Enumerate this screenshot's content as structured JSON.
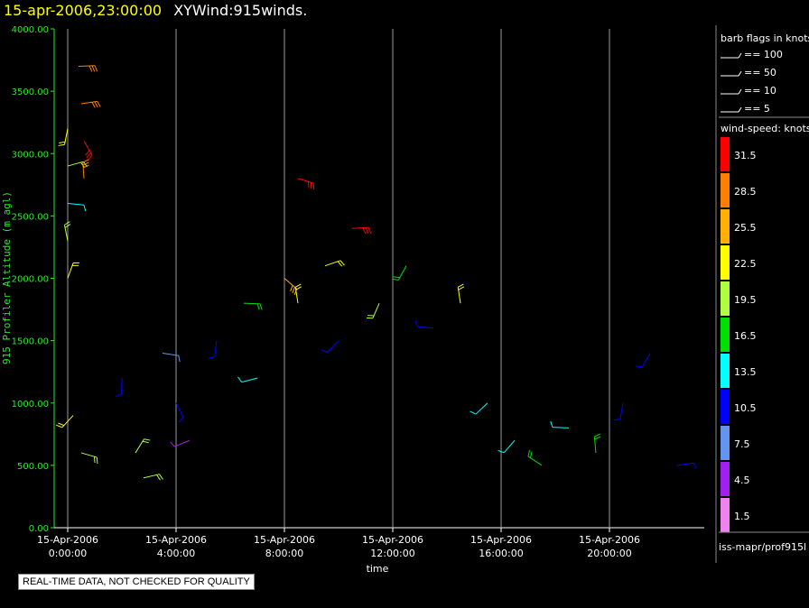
{
  "header": {
    "date_time": "15-apr-2006,23:00:00",
    "product": "XYWind:915winds."
  },
  "legend": {
    "barb_title": "barb flags in knots",
    "barb_items": [
      "== 100",
      "== 50",
      "== 10",
      "== 5"
    ],
    "speed_title": "wind-speed: knots",
    "speed_bins": [
      {
        "label": "31.5",
        "color": "#ff0000"
      },
      {
        "label": "28.5",
        "color": "#ff8000"
      },
      {
        "label": "25.5",
        "color": "#ffb000"
      },
      {
        "label": "22.5",
        "color": "#ffff00"
      },
      {
        "label": "19.5",
        "color": "#b0ff40"
      },
      {
        "label": "16.5",
        "color": "#00e000"
      },
      {
        "label": "13.5",
        "color": "#00ffff"
      },
      {
        "label": "10.5",
        "color": "#0000ff"
      },
      {
        "label": "7.5",
        "color": "#6495ed"
      },
      {
        "label": "4.5",
        "color": "#a020f0"
      },
      {
        "label": "1.5",
        "color": "#ee82ee"
      }
    ]
  },
  "source_label": "iss-mapr/prof915l",
  "qc_note": "REAL-TIME DATA, NOT CHECKED FOR QUALITY",
  "chart_data": {
    "type": "scatter",
    "title": "15-apr-2006,23:00:00  XYWind:915winds.",
    "xlabel": "time",
    "ylabel": "915 Profiler Altitude (m agl)",
    "ylim": [
      0,
      4000
    ],
    "xlim_hours": [
      -0.5,
      23.5
    ],
    "y_ticks": [
      "0.00",
      "500.00",
      "1000.00",
      "1500.00",
      "2000.00",
      "2500.00",
      "3000.00",
      "3500.00",
      "4000.00"
    ],
    "y_tick_values": [
      0,
      500,
      1000,
      1500,
      2000,
      2500,
      3000,
      3500,
      4000
    ],
    "x_ticks": [
      {
        "hour": 0,
        "date": "15-Apr-2006",
        "time": "0:00:00"
      },
      {
        "hour": 4,
        "date": "15-Apr-2006",
        "time": "4:00:00"
      },
      {
        "hour": 8,
        "date": "15-Apr-2006",
        "time": "8:00:00"
      },
      {
        "hour": 12,
        "date": "15-Apr-2006",
        "time": "12:00:00"
      },
      {
        "hour": 16,
        "date": "15-Apr-2006",
        "time": "16:00:00"
      },
      {
        "hour": 20,
        "date": "15-Apr-2006",
        "time": "20:00:00"
      }
    ],
    "grid": "vertical lines at x ticks",
    "wind_barbs": [
      {
        "hour": 0.0,
        "alt": 2000,
        "speed": 22
      },
      {
        "hour": 0.0,
        "alt": 2300,
        "speed": 20
      },
      {
        "hour": 0.0,
        "alt": 2600,
        "speed": 12
      },
      {
        "hour": 0.0,
        "alt": 2900,
        "speed": 20
      },
      {
        "hour": 0.0,
        "alt": 3200,
        "speed": 22
      },
      {
        "hour": 0.4,
        "alt": 3700,
        "speed": 27
      },
      {
        "hour": 0.5,
        "alt": 3400,
        "speed": 28
      },
      {
        "hour": 0.6,
        "alt": 3100,
        "speed": 31
      },
      {
        "hour": 0.6,
        "alt": 2800,
        "speed": 28
      },
      {
        "hour": 0.2,
        "alt": 900,
        "speed": 22
      },
      {
        "hour": 0.5,
        "alt": 600,
        "speed": 20
      },
      {
        "hour": 2.0,
        "alt": 1200,
        "speed": 10
      },
      {
        "hour": 2.5,
        "alt": 600,
        "speed": 18
      },
      {
        "hour": 2.8,
        "alt": 400,
        "speed": 20
      },
      {
        "hour": 3.5,
        "alt": 1400,
        "speed": 7
      },
      {
        "hour": 4.0,
        "alt": 1000,
        "speed": 10
      },
      {
        "hour": 4.5,
        "alt": 700,
        "speed": 4
      },
      {
        "hour": 5.5,
        "alt": 1500,
        "speed": 9
      },
      {
        "hour": 6.5,
        "alt": 1800,
        "speed": 15
      },
      {
        "hour": 7.0,
        "alt": 1200,
        "speed": 12
      },
      {
        "hour": 8.0,
        "alt": 2000,
        "speed": 25
      },
      {
        "hour": 8.5,
        "alt": 1800,
        "speed": 22
      },
      {
        "hour": 8.5,
        "alt": 2800,
        "speed": 31
      },
      {
        "hour": 9.5,
        "alt": 2100,
        "speed": 23
      },
      {
        "hour": 10.0,
        "alt": 1500,
        "speed": 10
      },
      {
        "hour": 10.5,
        "alt": 2400,
        "speed": 32
      },
      {
        "hour": 11.5,
        "alt": 1800,
        "speed": 18
      },
      {
        "hour": 12.5,
        "alt": 2100,
        "speed": 17
      },
      {
        "hour": 13.5,
        "alt": 1600,
        "speed": 11
      },
      {
        "hour": 14.5,
        "alt": 1800,
        "speed": 22
      },
      {
        "hour": 15.5,
        "alt": 1000,
        "speed": 12
      },
      {
        "hour": 16.5,
        "alt": 700,
        "speed": 13
      },
      {
        "hour": 17.5,
        "alt": 500,
        "speed": 16
      },
      {
        "hour": 18.5,
        "alt": 800,
        "speed": 14
      },
      {
        "hour": 19.5,
        "alt": 600,
        "speed": 17
      },
      {
        "hour": 20.5,
        "alt": 1000,
        "speed": 11
      },
      {
        "hour": 21.5,
        "alt": 1400,
        "speed": 10
      },
      {
        "hour": 22.5,
        "alt": 500,
        "speed": 10
      }
    ]
  }
}
